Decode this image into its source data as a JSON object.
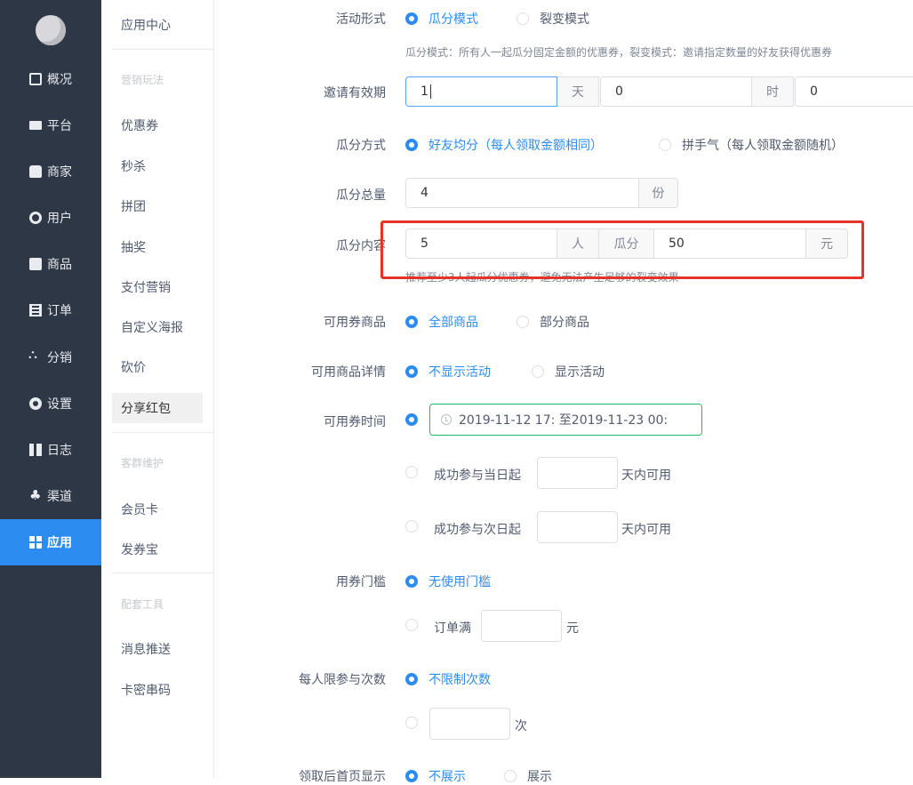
{
  "nav": {
    "items": [
      {
        "label": "概况",
        "icon": "chart-icon"
      },
      {
        "label": "平台",
        "icon": "monitor-icon"
      },
      {
        "label": "商家",
        "icon": "store-icon"
      },
      {
        "label": "用户",
        "icon": "user-icon"
      },
      {
        "label": "商品",
        "icon": "bag-icon"
      },
      {
        "label": "订单",
        "icon": "list-icon"
      },
      {
        "label": "分销",
        "icon": "tree-icon"
      },
      {
        "label": "设置",
        "icon": "gear-icon"
      },
      {
        "label": "日志",
        "icon": "book-icon"
      },
      {
        "label": "渠道",
        "icon": "cluster-icon"
      },
      {
        "label": "应用",
        "icon": "apps-icon"
      }
    ],
    "active": "应用"
  },
  "subnav": {
    "title": "应用中心",
    "group1": "营销玩法",
    "items1": [
      "优惠券",
      "秒杀",
      "拼团",
      "抽奖",
      "支付营销",
      "自定义海报",
      "砍价",
      "分享红包"
    ],
    "group2": "客群维护",
    "items2": [
      "会员卡",
      "发券宝"
    ],
    "group3": "配套工具",
    "items3": [
      "消息推送",
      "卡密串码"
    ],
    "active": "分享红包"
  },
  "form": {
    "activity_type": {
      "label": "活动形式",
      "opt1": "瓜分模式",
      "opt2": "裂变模式",
      "help": "瓜分模式：所有人一起瓜分固定金额的优惠券，裂变模式：邀请指定数量的好友获得优惠券"
    },
    "invite_valid": {
      "label": "邀请有效期",
      "days_value": "1",
      "days_unit": "天",
      "hours_value": "0",
      "hours_unit": "时",
      "minutes_value": "0"
    },
    "split_method": {
      "label": "瓜分方式",
      "opt1": "好友均分（每人领取金额相同）",
      "opt2": "拼手气（每人领取金额随机）"
    },
    "split_total": {
      "label": "瓜分总量",
      "value": "4",
      "unit": "份"
    },
    "split_content": {
      "label": "瓜分内容",
      "people_value": "5",
      "people_unit": "人",
      "split_word": "瓜分",
      "amount_value": "50",
      "amount_unit": "元",
      "help": "推荐至少3人起瓜分优惠券，避免无法产生足够的裂变效果"
    },
    "coupon_goods": {
      "label": "可用券商品",
      "opt1": "全部商品",
      "opt2": "部分商品"
    },
    "goods_detail": {
      "label": "可用商品详情",
      "opt1": "不显示活动",
      "opt2": "显示活动"
    },
    "coupon_time": {
      "label": "可用券时间",
      "range": "2019-11-12 17: 至2019-11-23 00:",
      "opt2_prefix": "成功参与当日起",
      "opt2_suffix": "天内可用",
      "opt3_prefix": "成功参与次日起",
      "opt3_suffix": "天内可用"
    },
    "threshold": {
      "label": "用券门槛",
      "opt1": "无使用门槛",
      "opt2_prefix": "订单满",
      "opt2_suffix": "元"
    },
    "limit": {
      "label": "每人限参与次数",
      "opt1": "不限制次数",
      "opt2_suffix": "次"
    },
    "home_display": {
      "label": "领取后首页显示",
      "opt1": "不展示",
      "opt2": "展示"
    }
  }
}
